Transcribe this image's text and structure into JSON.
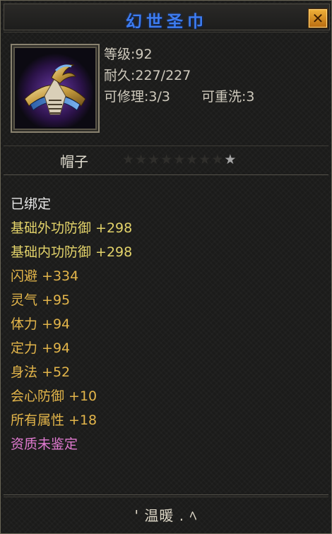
{
  "window": {
    "title": "幻世圣巾",
    "close_icon": "close-icon"
  },
  "item": {
    "icon": "hat-icon",
    "level_text": "等级:92",
    "durability_text": "耐久:227/227",
    "repairable_text": "可修理:3/3",
    "rewashable_text": "可重洗:3",
    "type_label": "帽子",
    "stars": {
      "total": 9,
      "lit": 1
    }
  },
  "attributes": [
    {
      "text": "已绑定",
      "color": "white"
    },
    {
      "text": "基础外功防御 +298",
      "color": "yellow"
    },
    {
      "text": "基础内功防御 +298",
      "color": "yellow"
    },
    {
      "text": "闪避 +334",
      "color": "gold"
    },
    {
      "text": "灵气 +95",
      "color": "gold"
    },
    {
      "text": "体力 +94",
      "color": "gold"
    },
    {
      "text": "定力 +94",
      "color": "gold"
    },
    {
      "text": "身法 +52",
      "color": "gold"
    },
    {
      "text": "会心防御 +10",
      "color": "gold"
    },
    {
      "text": "所有属性 +18",
      "color": "gold"
    },
    {
      "text": "资质未鉴定",
      "color": "pink"
    }
  ],
  "signature": "' 温暖 . ﾍ",
  "colors": {
    "title": "#3d7cf0",
    "white": "#e8e8e8",
    "yellow": "#e3d36a",
    "gold": "#e3b54a",
    "pink": "#e07ad0",
    "close_button": "#e09a2a"
  }
}
